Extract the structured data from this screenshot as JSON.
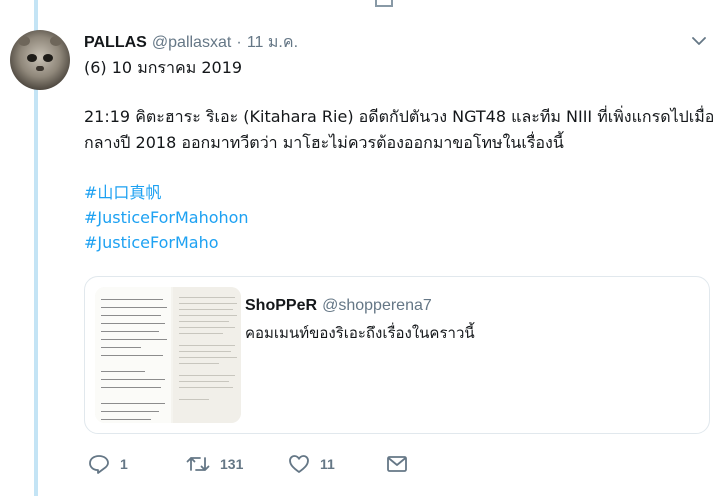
{
  "tweet": {
    "author_name": "PALLAS",
    "author_handle": "@pallasxat",
    "separator": "·",
    "date": "11 ม.ค.",
    "line1": "(6) 10 มกราคม 2019",
    "body_lines": [
      "21:19 คิตะฮาระ ริเอะ (Kitahara Rie) อดีตกัปตันวง NGT48 และทีม NIII ที่เพิ่งแกรดไปเมื่อ",
      "กลางปี 2018 ออกมาทวีตว่า มาโฮะไม่ควรต้องออกมาขอโทษในเรื่องนี้"
    ],
    "hashtags": [
      "#山口真帆",
      "#JusticeForMahohon",
      "#JusticeForMaho"
    ]
  },
  "quoted": {
    "author_name": "ShoPPeR",
    "author_handle": "@shopperena7",
    "text": "คอมเมนท์ของริเอะถึงเรื่องในคราวนี้"
  },
  "actions": {
    "reply_count": "1",
    "retweet_count": "131",
    "like_count": "11"
  },
  "icons": {
    "reply": "reply-icon",
    "retweet": "retweet-icon",
    "like": "heart-icon",
    "message": "envelope-icon",
    "menu": "chevron-down-icon"
  },
  "colors": {
    "link": "#1da1f2",
    "muted": "#657786",
    "thread_line": "#c4e4f5"
  }
}
